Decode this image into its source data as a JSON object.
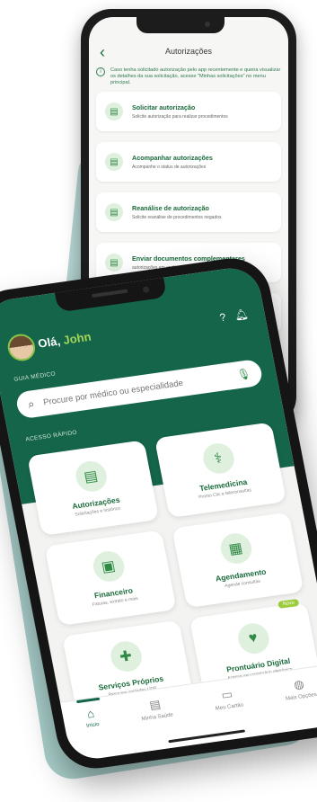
{
  "back_screen": {
    "title": "Autorizações",
    "info": "Caso tenha solicitado autorização pelo app recentemente e queira visualizar os detalhes da sua solicitação, acesse \"Minhas solicitações\" no menu principal.",
    "cards": [
      {
        "title": "Solicitar autorização",
        "subtitle": "Solicite autorização para realizar procedimentos",
        "icon": "document-add-icon"
      },
      {
        "title": "Acompanhar autorizações",
        "subtitle": "Acompanhe o status de autorizações",
        "icon": "document-list-icon"
      },
      {
        "title": "Reanálise de autorização",
        "subtitle": "Solicite reanálise de procedimentos negados",
        "icon": "document-refresh-icon"
      },
      {
        "title": "Enviar documentos complementares",
        "subtitle": "autorizações em análise",
        "icon": "document-upload-icon"
      },
      {
        "title": "",
        "subtitle": "",
        "icon": "document-icon"
      }
    ]
  },
  "front_screen": {
    "greeting": "Olá,",
    "user_name": "John",
    "guide_label": "GUIA MÉDICO",
    "search_placeholder": "Procure por médico ou especialidade",
    "quick_access_label": "ACESSO RÁPIDO",
    "tiles": [
      {
        "label": "Autorizações",
        "subtitle": "Solicitações e histórico",
        "icon": "document-check-icon"
      },
      {
        "label": "Telemedicina",
        "subtitle": "Pronto Clic e teleconsultas",
        "icon": "stethoscope-icon"
      },
      {
        "label": "Financeiro",
        "subtitle": "Faturas, extrato e mais",
        "icon": "wallet-icon"
      },
      {
        "label": "Agendamento",
        "subtitle": "Agende consultas",
        "icon": "calendar-icon"
      },
      {
        "label": "Serviços Próprios",
        "subtitle": "Pesquise unidades UDP",
        "icon": "first-aid-icon",
        "badge": "Novo"
      },
      {
        "label": "Prontuário Digital",
        "subtitle": "Acesse seu prontuário eletrônico",
        "icon": "clipboard-heart-icon"
      }
    ],
    "tabs": [
      {
        "label": "Início",
        "icon": "home-icon",
        "active": true
      },
      {
        "label": "Minha Saúde",
        "icon": "health-file-icon"
      },
      {
        "label": "Meu Cartão",
        "icon": "card-icon"
      },
      {
        "label": "Mais Opções",
        "icon": "more-icon"
      }
    ]
  },
  "colors": {
    "brand_green": "#14654a",
    "accent_lime": "#a5d65a",
    "backdrop_teal": "#a9cfcb"
  }
}
